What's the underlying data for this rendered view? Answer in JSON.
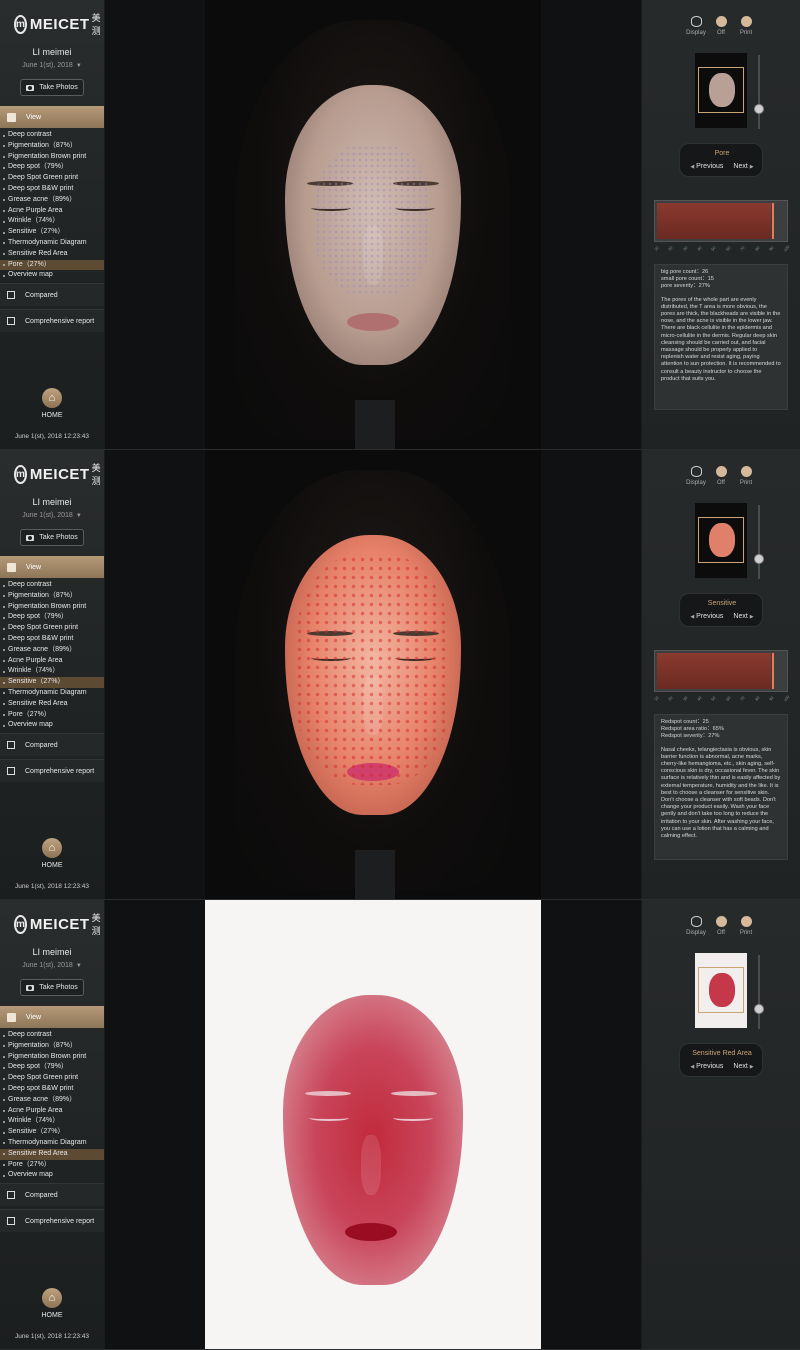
{
  "app": {
    "brand": "MEICET",
    "brand_cn": "美测",
    "user": "LI meimei",
    "date": "June 1(st), 2018",
    "take_photos": "Take Photos",
    "view": "View",
    "compared": "Compared",
    "report": "Comprehensive report",
    "home": "HOME",
    "timestamp": "June 1(st), 2018 12:23:43",
    "display": "Display",
    "off": "Off",
    "print": "Print",
    "previous": "Previous",
    "next": "Next"
  },
  "menu": [
    "Deep contrast",
    "Pigmentation（87%）",
    "Pigmentation Brown print",
    "Deep spot（79%）",
    "Deep Spot Green print",
    "Deep spot B&W print",
    "Grease acne（89%）",
    "Acne Purple Area",
    "Wrinkle（74%）",
    "Sensitive（27%）",
    "Thermodynamic Diagram",
    "Sensitive Red Area",
    "Pore（27%）",
    "Overview map"
  ],
  "ticks": [
    "10",
    "20",
    "30",
    "40",
    "50",
    "60",
    "70",
    "80",
    "90",
    "100"
  ],
  "panels": [
    {
      "mode": "Pore",
      "active_index": 12,
      "gauge_level": 0.88,
      "stats": [
        "big pore count：26",
        "small pore count：15",
        "pore severity：27%"
      ],
      "text": "The pores of the whole part are evenly distributed, the T area is more obvious, the pores are thick, the blackheads are visible in the nose, and the acne is visible in the lower jaw. There are black cellulite in the epidermis and micro-cellulite in the dermis. Regular deep skin cleansing should be carried out, and facial massage should be properly applied to replenish water and resist aging, paying attention to sun protection. It is recommended to consult a beauty instructor to choose the product that suits you."
    },
    {
      "mode": "Sensitive",
      "active_index": 9,
      "gauge_level": 0.88,
      "stats": [
        "Redspot count：25",
        "Redspot area ratio：65%",
        "Redspot severity：27%"
      ],
      "text": "Nasal cheeks, telangiectasia is obvious, skin barrier function is abnormal, acne marks, cherry-like hemangioma, etc., skin aging, self-conscious skin is dry, occasional fever. The skin surface is relatively thin and is easily affected by external temperature, humidity and the like. It is best to choose a cleanser for sensitive skin. Don't choose a cleanser with soft beads. Don't change your product easily. Wash your face gently and don't take too long to reduce the irritation to your skin. After washing your face, you can use a lotion that has a calming and calming effect."
    },
    {
      "mode": "Sensitive Red Area",
      "active_index": 11
    }
  ]
}
